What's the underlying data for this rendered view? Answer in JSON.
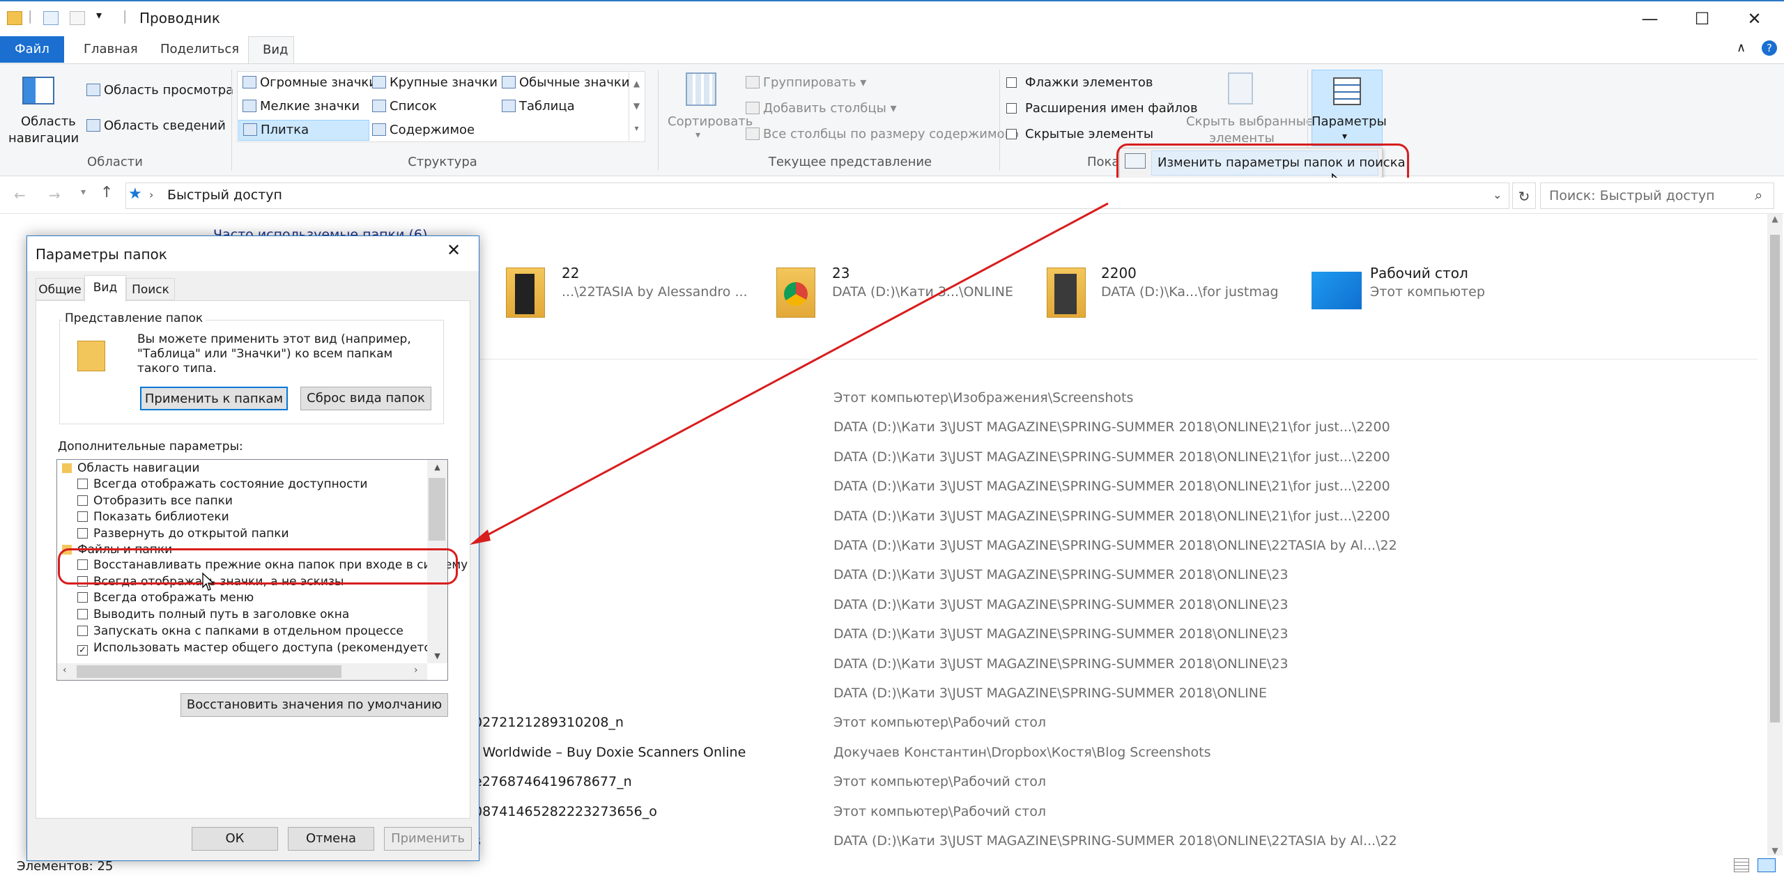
{
  "window": {
    "title": "Проводник"
  },
  "tabs": [
    {
      "label": "Файл"
    },
    {
      "label": "Главная"
    },
    {
      "label": "Поделиться"
    },
    {
      "label": "Вид"
    }
  ],
  "ribbon": {
    "areas": {
      "nav_pane_line1": "Область",
      "nav_pane_line2": "навигации",
      "preview_pane": "Область просмотра",
      "details_pane": "Область сведений",
      "label": "Области"
    },
    "structure": {
      "items": [
        "Огромные значки",
        "Крупные значки",
        "Обычные значки",
        "Мелкие значки",
        "Список",
        "Таблица",
        "Плитка",
        "Содержимое"
      ],
      "label": "Структура"
    },
    "current_view": {
      "sort": "Сортировать",
      "group": "Группировать",
      "add_columns": "Добавить столбцы",
      "fit_columns": "Все столбцы по размеру содержимого",
      "label": "Текущее представление"
    },
    "show_hide": {
      "item_checkboxes": "Флажки элементов",
      "file_extensions": "Расширения имен файлов",
      "hidden_items": "Скрытые элементы",
      "hide_selected_line1": "Скрыть выбранные",
      "hide_selected_line2": "элементы",
      "label": "Пока"
    },
    "options": {
      "label": "Параметры",
      "dropdown_item": "Изменить параметры папок и поиска"
    }
  },
  "address": {
    "path": "Быстрый доступ",
    "search_placeholder": "Поиск: Быстрый доступ"
  },
  "frequent_header": "Часто используемые папки (6)",
  "folders": [
    {
      "name": "22",
      "sub": "...\\22TASIA by Alessandro ..."
    },
    {
      "name": "23",
      "sub": "DATA (D:)\\Кати 3...\\ONLINE"
    },
    {
      "name": "2200",
      "sub": "DATA (D:)\\Ka...\\for justmag"
    },
    {
      "name": "Рабочий стол",
      "sub": "Этот компьютер"
    }
  ],
  "recent_rows": [
    {
      "name": "",
      "path": "Этот компьютер\\Изображения\\Screenshots"
    },
    {
      "name": "",
      "path": "DATA (D:)\\Кати 3\\JUST MAGAZINE\\SPRING-SUMMER 2018\\ONLINE\\21\\for just...\\2200"
    },
    {
      "name": "",
      "path": "DATA (D:)\\Кати 3\\JUST MAGAZINE\\SPRING-SUMMER 2018\\ONLINE\\21\\for just...\\2200"
    },
    {
      "name": "",
      "path": "DATA (D:)\\Кати 3\\JUST MAGAZINE\\SPRING-SUMMER 2018\\ONLINE\\21\\for just...\\2200"
    },
    {
      "name": "",
      "path": "DATA (D:)\\Кати 3\\JUST MAGAZINE\\SPRING-SUMMER 2018\\ONLINE\\21\\for just...\\2200"
    },
    {
      "name": "",
      "path": "DATA (D:)\\Кати 3\\JUST MAGAZINE\\SPRING-SUMMER 2018\\ONLINE\\22TASIA by Al...\\22"
    },
    {
      "name": "",
      "path": "DATA (D:)\\Кати 3\\JUST MAGAZINE\\SPRING-SUMMER 2018\\ONLINE\\23"
    },
    {
      "name": "",
      "path": "DATA (D:)\\Кати 3\\JUST MAGAZINE\\SPRING-SUMMER 2018\\ONLINE\\23"
    },
    {
      "name": "",
      "path": "DATA (D:)\\Кати 3\\JUST MAGAZINE\\SPRING-SUMMER 2018\\ONLINE\\23"
    },
    {
      "name": "",
      "path": "DATA (D:)\\Кати 3\\JUST MAGAZINE\\SPRING-SUMMER 2018\\ONLINE\\23"
    },
    {
      "name": "",
      "path": "DATA (D:)\\Кати 3\\JUST MAGAZINE\\SPRING-SUMMER 2018\\ONLINE"
    },
    {
      "name": "0272121289310208_n",
      "path": "Этот компьютер\\Рабочий стол"
    },
    {
      "name": "/ Worldwide – Buy Doxie Scanners Online",
      "path": "Докучаев Константин\\Dropbox\\Костя\\Blog Screenshots"
    },
    {
      "name": "e2768746419678677_n",
      "path": "Этот компьютер\\Рабочий стол"
    },
    {
      "name": "08741465282223273656_o",
      "path": "Этот компьютер\\Рабочий стол"
    },
    {
      "name": "s",
      "path": "DATA (D:)\\Кати 3\\JUST MAGAZINE\\SPRING-SUMMER 2018\\ONLINE\\22TASIA by Al...\\22"
    }
  ],
  "status": {
    "items_count": "Элементов: 25"
  },
  "dialog": {
    "title": "Параметры папок",
    "tabs": [
      "Общие",
      "Вид",
      "Поиск"
    ],
    "folder_view_group": "Представление папок",
    "folder_view_text_1": "Вы можете применить этот вид (например,",
    "folder_view_text_2": "\"Таблица\" или \"Значки\") ко всем папкам",
    "folder_view_text_3": "такого типа.",
    "apply_to_folders": "Применить к папкам",
    "reset_folders": "Сброс вида папок",
    "advanced_label": "Дополнительные параметры:",
    "tree": {
      "nav_header": "Область навигации",
      "nav_items": [
        {
          "label": "Всегда отображать состояние доступности",
          "checked": false
        },
        {
          "label": "Отобразить все папки",
          "checked": false
        },
        {
          "label": "Показать библиотеки",
          "checked": false
        },
        {
          "label": "Развернуть до открытой папки",
          "checked": false
        }
      ],
      "files_header": "Файлы и папки",
      "files_items": [
        {
          "label": "Восстанавливать прежние окна папок при входе в систему",
          "checked": false
        },
        {
          "label": "Всегда отображать значки, а не эскизы",
          "checked": false
        },
        {
          "label": "Всегда отображать меню",
          "checked": false
        },
        {
          "label": "Выводить полный путь в заголовке окна",
          "checked": false
        },
        {
          "label": "Запускать окна с папками в отдельном процессе",
          "checked": false
        },
        {
          "label": "Использовать мастер общего доступа (рекомендуется)",
          "checked": true
        }
      ]
    },
    "restore_defaults": "Восстановить значения по умолчанию",
    "ok": "ОК",
    "cancel": "Отмена",
    "apply": "Применить"
  },
  "colors": {
    "accent": "#1a6fd0",
    "annotation": "#d81d1d",
    "selected": "#cce8ff"
  }
}
